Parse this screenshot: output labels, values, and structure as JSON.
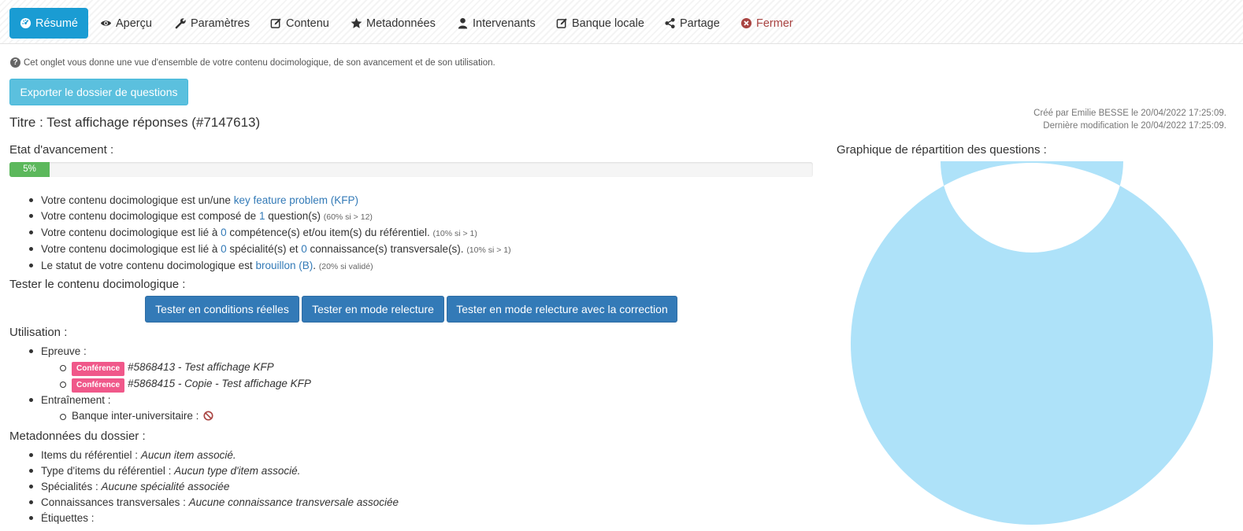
{
  "tabs": [
    {
      "label": "Résumé",
      "icon": "dashboard-icon",
      "active": true
    },
    {
      "label": "Aperçu",
      "icon": "eye-icon"
    },
    {
      "label": "Paramètres",
      "icon": "wrench-icon"
    },
    {
      "label": "Contenu",
      "icon": "edit-icon"
    },
    {
      "label": "Metadonnées",
      "icon": "star-icon"
    },
    {
      "label": "Intervenants",
      "icon": "user-icon"
    },
    {
      "label": "Banque locale",
      "icon": "edit-icon"
    },
    {
      "label": "Partage",
      "icon": "share-icon"
    },
    {
      "label": "Fermer",
      "icon": "close-circle-icon"
    }
  ],
  "hint": "Cet onglet vous donne une vue d'ensemble de votre contenu docimologique, de son avancement et de son utilisation.",
  "export_label": "Exporter le dossier de questions",
  "meta": {
    "created": "Créé par Emilie BESSE le 20/04/2022 17:25:09.",
    "modified": "Dernière modification le 20/04/2022 17:25:09."
  },
  "title": "Titre : Test affichage réponses (#7147613)",
  "progress": {
    "heading": "Etat d'avancement :",
    "percent": 5,
    "label": "5%"
  },
  "status_list": [
    {
      "text": "Votre contenu docimologique est un/une ",
      "link": "key feature problem (KFP)",
      "after": "",
      "note": ""
    },
    {
      "text": "Votre contenu docimologique est composé de ",
      "link": "1",
      "after": " question(s) ",
      "note": "(60% si > 12)"
    },
    {
      "text": "Votre contenu docimologique est lié à ",
      "link": "0",
      "after": " compétence(s) et/ou item(s) du référentiel. ",
      "note": "(10% si > 1)"
    },
    {
      "text": "Votre contenu docimologique est lié à ",
      "link": "0",
      "after": " spécialité(s) et ",
      "link2": "0",
      "after2": " connaissance(s) transversale(s). ",
      "note": "(10% si > 1)"
    },
    {
      "text": "Le statut de votre contenu docimologique est ",
      "link": "brouillon (B)",
      "after": ". ",
      "note": "(20% si validé)"
    }
  ],
  "test": {
    "heading": "Tester le contenu docimologique :",
    "buttons": [
      "Tester en conditions réelles",
      "Tester en mode relecture",
      "Tester en mode relecture avec la correction"
    ]
  },
  "usage": {
    "heading": "Utilisation :",
    "epreuve_label": "Epreuve :",
    "epreuves": [
      {
        "badge": "Conférence",
        "text": "#5868413 - Test affichage KFP"
      },
      {
        "badge": "Conférence",
        "text": "#5868415 - Copie - Test affichage KFP"
      }
    ],
    "entrainement_label": "Entraînement :",
    "banque_label": "Banque inter-universitaire :"
  },
  "metadata": {
    "heading": "Metadonnées du dossier :",
    "items": [
      {
        "label": "Items du référentiel : ",
        "value": "Aucun item associé."
      },
      {
        "label": "Type d'items du référentiel : ",
        "value": "Aucun type d'item associé."
      },
      {
        "label": "Spécialités : ",
        "value": "Aucune spécialité associée"
      },
      {
        "label": "Connaissances transversales : ",
        "value": "Aucune connaissance transversale associée"
      },
      {
        "label": "Étiquettes :",
        "value": ""
      }
    ]
  },
  "chart_data": {
    "type": "pie",
    "title": "Graphique de répartition des questions :",
    "categories": [
      ""
    ],
    "values": [
      1
    ],
    "colors": [
      "#aee2f9"
    ]
  }
}
